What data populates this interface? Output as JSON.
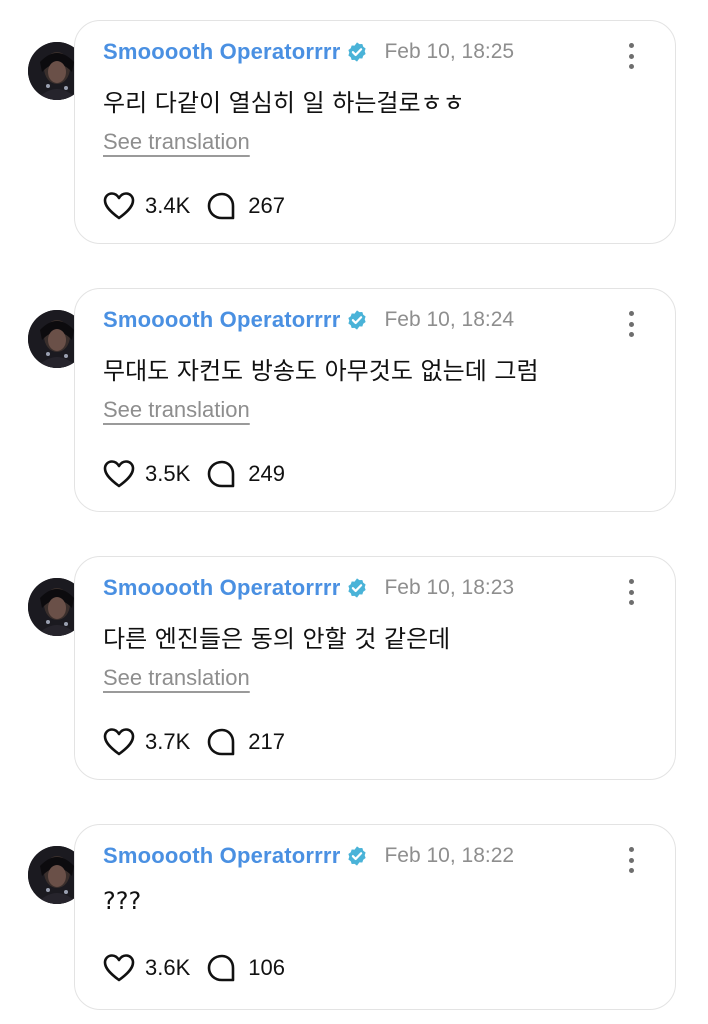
{
  "posts": [
    {
      "author": "Smooooth Operatorrrr",
      "timestamp": "Feb 10, 18:25",
      "text": "우리 다같이 열심히 일 하는걸로ㅎㅎ",
      "translate_label": "See translation",
      "likes": "3.4K",
      "comments": "267"
    },
    {
      "author": "Smooooth Operatorrrr",
      "timestamp": "Feb 10, 18:24",
      "text": "무대도 자컨도 방송도 아무것도 없는데 그럼",
      "translate_label": "See translation",
      "likes": "3.5K",
      "comments": "249"
    },
    {
      "author": "Smooooth Operatorrrr",
      "timestamp": "Feb 10, 18:23",
      "text": "다른 엔진들은 동의 안할 것 같은데",
      "translate_label": "See translation",
      "likes": "3.7K",
      "comments": "217"
    },
    {
      "author": "Smooooth Operatorrrr",
      "timestamp": "Feb 10, 18:22",
      "text": "???",
      "likes": "3.6K",
      "comments": "106"
    }
  ],
  "colors": {
    "author_name": "#4a90e2",
    "verified_badge": "#4ab3d8",
    "timestamp": "#8e8e8e",
    "card_border": "#e3e3e3"
  },
  "icons": [
    "verified-badge-icon",
    "more-options-icon",
    "heart-icon",
    "comment-icon",
    "avatar"
  ]
}
